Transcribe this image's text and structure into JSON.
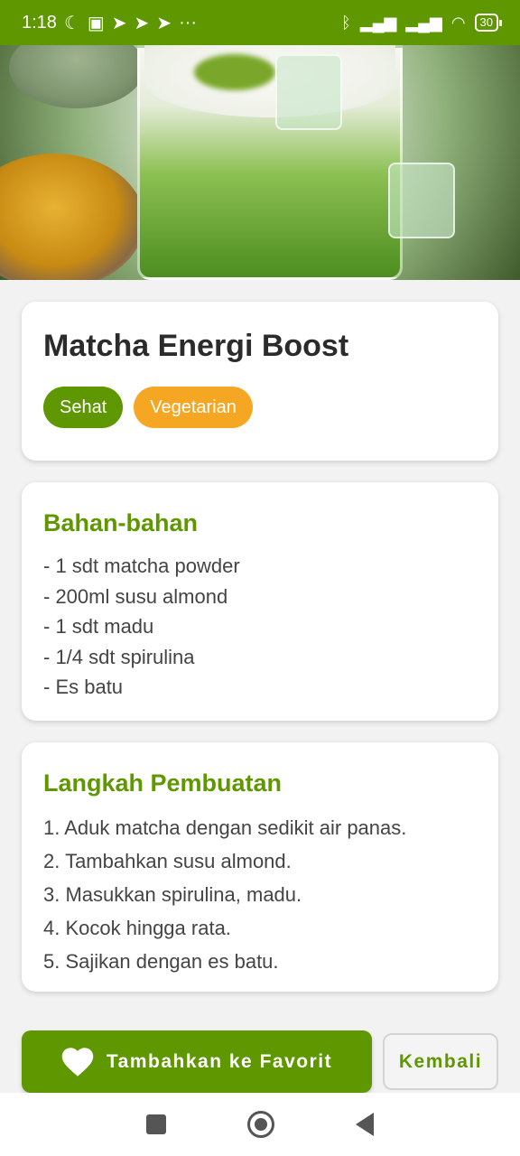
{
  "status_bar": {
    "time": "1:18",
    "left_icons": [
      "moon-icon",
      "nfc-icon",
      "telegram-icon",
      "telegram-icon",
      "telegram-icon",
      "more-dots-icon"
    ],
    "right_icons": [
      "bluetooth-icon",
      "signal-icon",
      "signal-icon",
      "wifi-icon"
    ],
    "battery": "30",
    "more": "···"
  },
  "recipe": {
    "title": "Matcha Energi Boost",
    "tags": [
      "Sehat",
      "Vegetarian"
    ]
  },
  "ingredients": {
    "heading": "Bahan-bahan",
    "items": [
      "- 1 sdt matcha powder",
      "- 200ml susu almond",
      "- 1 sdt madu",
      "- 1/4 sdt spirulina",
      "- Es batu"
    ]
  },
  "steps": {
    "heading": "Langkah Pembuatan",
    "items": [
      "1. Aduk matcha dengan sedikit air panas.",
      "2. Tambahkan susu almond.",
      "3. Masukkan spirulina, madu.",
      "4. Kocok hingga rata.",
      "5. Sajikan dengan es batu."
    ]
  },
  "actions": {
    "favorite_label": "Tambahkan ke Favorit",
    "back_label": "Kembali"
  },
  "colors": {
    "primary": "#5e9700",
    "accent": "#f5a623"
  }
}
